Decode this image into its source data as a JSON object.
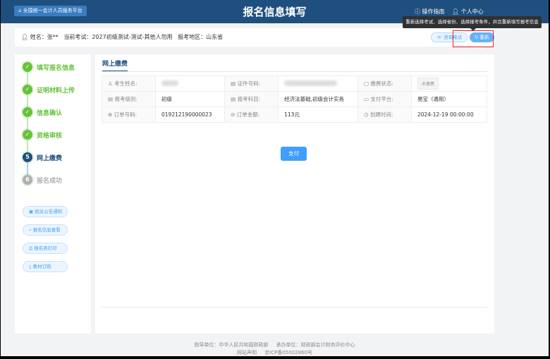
{
  "header": {
    "home_label": "全国统一会计人员服务平台",
    "title": "报名信息填写",
    "guide": "操作指南",
    "user_center": "个人中心"
  },
  "tooltip": "重新选择考试、选择省份、选择报考条件，并且重新填写报考信息",
  "info_bar": {
    "name": "姓名：张**",
    "exam": "当前考试：2027初级测试-测试-其他人勿用",
    "region": "报考地区：山东省",
    "consult_label": "咨询电话",
    "redo_label": "重新报名"
  },
  "steps": [
    {
      "n": "✓",
      "label": "填写报名信息",
      "state": "done"
    },
    {
      "n": "✓",
      "label": "证明材料上传",
      "state": "done"
    },
    {
      "n": "✓",
      "label": "信息确认",
      "state": "done"
    },
    {
      "n": "✓",
      "label": "资格审核",
      "state": "done"
    },
    {
      "n": "5",
      "label": "网上缴费",
      "state": "active"
    },
    {
      "n": "6",
      "label": "报名成功",
      "state": "pending"
    }
  ],
  "side_buttons": [
    "相关公告通知",
    "报名信息查看",
    "报名表打印",
    "教材订购"
  ],
  "main": {
    "tab": "网上缴费",
    "pay_label": "支付",
    "rows": [
      [
        {
          "label": "考生姓名:",
          "value": ""
        },
        {
          "label": "证件号码:",
          "value": ""
        },
        {
          "label": "缴费状态:",
          "value": "未缴费"
        }
      ],
      [
        {
          "label": "报考级别:",
          "value": "初级"
        },
        {
          "label": "报考科目:",
          "value": "经济法基础,初级会计实务"
        },
        {
          "label": "支付平台:",
          "value": "易宝（通用）"
        }
      ],
      [
        {
          "label": "订单号码:",
          "value": "019212190000023"
        },
        {
          "label": "订单金额:",
          "value": "113元"
        },
        {
          "label": "创建时间:",
          "value": "2024-12-19 00:00:00"
        }
      ]
    ]
  },
  "footer": {
    "line1a": "指导单位：中华人民共和国财政部",
    "line1b": "承办单位：财政部会计财务评价中心",
    "line2a": "网站声明",
    "line2b": "京ICP备05002860号"
  },
  "colors": {
    "header": "#1f4f7e",
    "done": "#67c23a",
    "active": "#1f4f7e",
    "pending": "#b0b0b0",
    "primary": "#409eff"
  }
}
